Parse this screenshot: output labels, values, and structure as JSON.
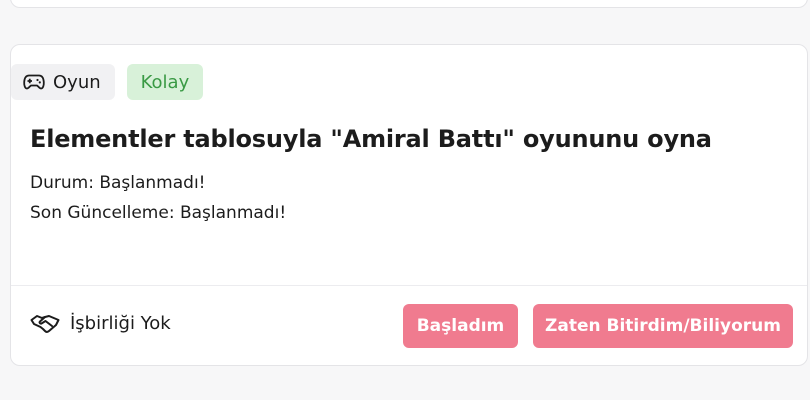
{
  "task": {
    "type_label": "Oyun",
    "type_icon": "gamepad-icon",
    "difficulty_label": "Kolay",
    "title": "Elementler tablosuyla \"Amiral Battı\" oyununu oyna",
    "status_key": "Durum:",
    "status_value": "Başlanmadı!",
    "updated_key": "Son Güncelleme:",
    "updated_value": "Başlanmadı!",
    "collab_icon": "handshake-icon",
    "collab_label": "İşbirliği Yok",
    "start_button": "Başladım",
    "done_button": "Zaten Bitirdim/Biliyorum"
  },
  "colors": {
    "accent_button": "#f07b8f",
    "difficulty_bg": "#d8f1d9",
    "difficulty_text": "#3a9a45"
  }
}
